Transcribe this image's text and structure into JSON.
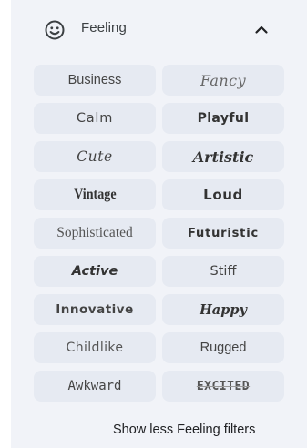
{
  "section": {
    "title": "Feeling",
    "icon": "smiley-face-icon",
    "toggle_icon": "chevron-up-icon"
  },
  "chips": [
    {
      "label": "Business",
      "style": "f-plain"
    },
    {
      "label": "Fancy",
      "style": "f-fancy"
    },
    {
      "label": "Calm",
      "style": "f-calm"
    },
    {
      "label": "Playful",
      "style": "f-playful"
    },
    {
      "label": "Cute",
      "style": "f-cute"
    },
    {
      "label": "Artistic",
      "style": "f-artistic"
    },
    {
      "label": "Vintage",
      "style": "f-vintage"
    },
    {
      "label": "Loud",
      "style": "f-loud"
    },
    {
      "label": "Sophisticated",
      "style": "f-soph"
    },
    {
      "label": "Futuristic",
      "style": "f-futur"
    },
    {
      "label": "Active",
      "style": "f-active"
    },
    {
      "label": "Stiff",
      "style": "f-stiff"
    },
    {
      "label": "Innovative",
      "style": "f-innov"
    },
    {
      "label": "Happy",
      "style": "f-happy"
    },
    {
      "label": "Childlike",
      "style": "f-child"
    },
    {
      "label": "Rugged",
      "style": "f-rugged"
    },
    {
      "label": "Awkward",
      "style": "f-awk"
    },
    {
      "label": "EXCITED",
      "style": "f-excited"
    }
  ],
  "footer": {
    "show_less_label": "Show less Feeling filters"
  },
  "colors": {
    "panel_bg": "#f1f3f8",
    "chip_bg": "#e6eaf2",
    "text": "#3c4043"
  }
}
